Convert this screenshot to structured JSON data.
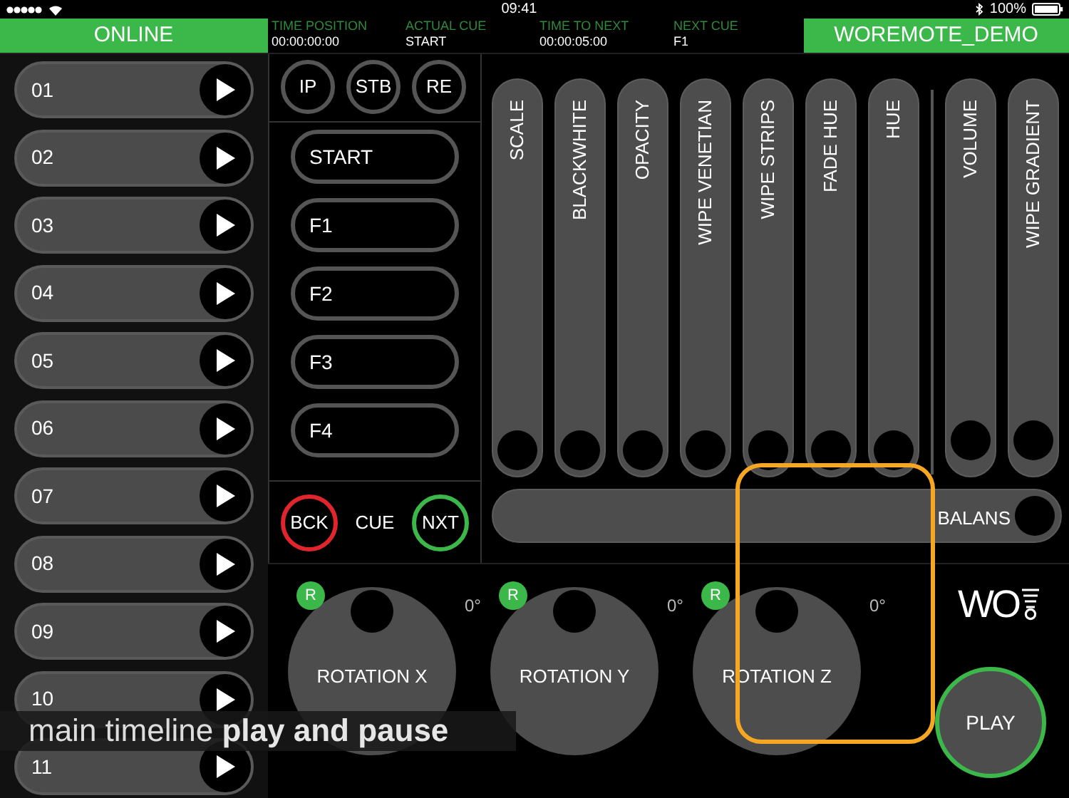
{
  "status_bar": {
    "time": "09:41",
    "battery": "100%"
  },
  "header": {
    "connection": "ONLINE",
    "project": "WOREMOTE_DEMO",
    "fields": [
      {
        "label": "TIME POSITION",
        "value": "00:00:00:00"
      },
      {
        "label": "ACTUAL CUE",
        "value": "START"
      },
      {
        "label": "TIME TO NEXT",
        "value": "00:00:05:00"
      },
      {
        "label": "NEXT CUE",
        "value": "F1"
      }
    ]
  },
  "timelines": [
    {
      "label": "01"
    },
    {
      "label": "02"
    },
    {
      "label": "03"
    },
    {
      "label": "04"
    },
    {
      "label": "05"
    },
    {
      "label": "06"
    },
    {
      "label": "07"
    },
    {
      "label": "08"
    },
    {
      "label": "09"
    },
    {
      "label": "10"
    },
    {
      "label": "11"
    }
  ],
  "mode_buttons": [
    "IP",
    "STB",
    "RE"
  ],
  "cues": [
    "START",
    "F1",
    "F2",
    "F3",
    "F4"
  ],
  "cue_nav": {
    "back": "BCK",
    "label": "CUE",
    "next": "NXT"
  },
  "slider_groups": [
    [
      {
        "label": "SCALE",
        "level": 0
      },
      {
        "label": "BLACKWHITE",
        "level": 0
      },
      {
        "label": "OPACITY",
        "level": 0
      },
      {
        "label": "WIPE VENETIAN",
        "level": 0
      },
      {
        "label": "WIPE STRIPS",
        "level": 0
      },
      {
        "label": "FADE HUE",
        "level": 0
      },
      {
        "label": "HUE",
        "level": 0
      }
    ],
    [
      {
        "label": "VOLUME",
        "level": 0.03
      },
      {
        "label": "WIPE GRADIENT",
        "level": 0.03
      }
    ]
  ],
  "balance": {
    "label": "BALANS",
    "level": 1
  },
  "rotations": [
    {
      "label": "ROTATION X",
      "reset": "R",
      "reading": "0°"
    },
    {
      "label": "ROTATION Y",
      "reset": "R",
      "reading": "0°"
    },
    {
      "label": "ROTATION Z",
      "reset": "R",
      "reading": "0°"
    }
  ],
  "logo": "WO",
  "play": "PLAY",
  "caption": "main timeline **play and pause**"
}
